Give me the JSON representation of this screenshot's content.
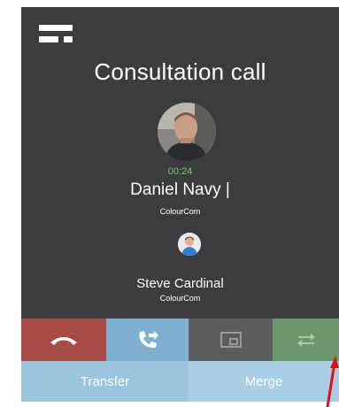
{
  "call": {
    "title": "Consultation call",
    "timer": "00:24",
    "primary_contact": {
      "name": "Daniel Navy |",
      "company": "ColourCom"
    },
    "secondary_contact": {
      "name": "Steve Cardinal",
      "company": "ColourCom"
    }
  },
  "actions": {
    "hangup_icon": "phone-hangup-icon",
    "transfer_icon": "phone-transfer-icon",
    "screen_icon": "screen-share-icon",
    "swap_icon": "swap-arrows-icon"
  },
  "buttons": {
    "transfer_label": "Transfer",
    "merge_label": "Merge"
  },
  "colors": {
    "panel_bg": "#3b3c3e",
    "timer_green": "#6fcf6a",
    "hangup_red": "#a84a46",
    "transfer_blue": "#7fb0cf",
    "swap_green": "#6a986c",
    "annotation_arrow": "#e0101a"
  }
}
